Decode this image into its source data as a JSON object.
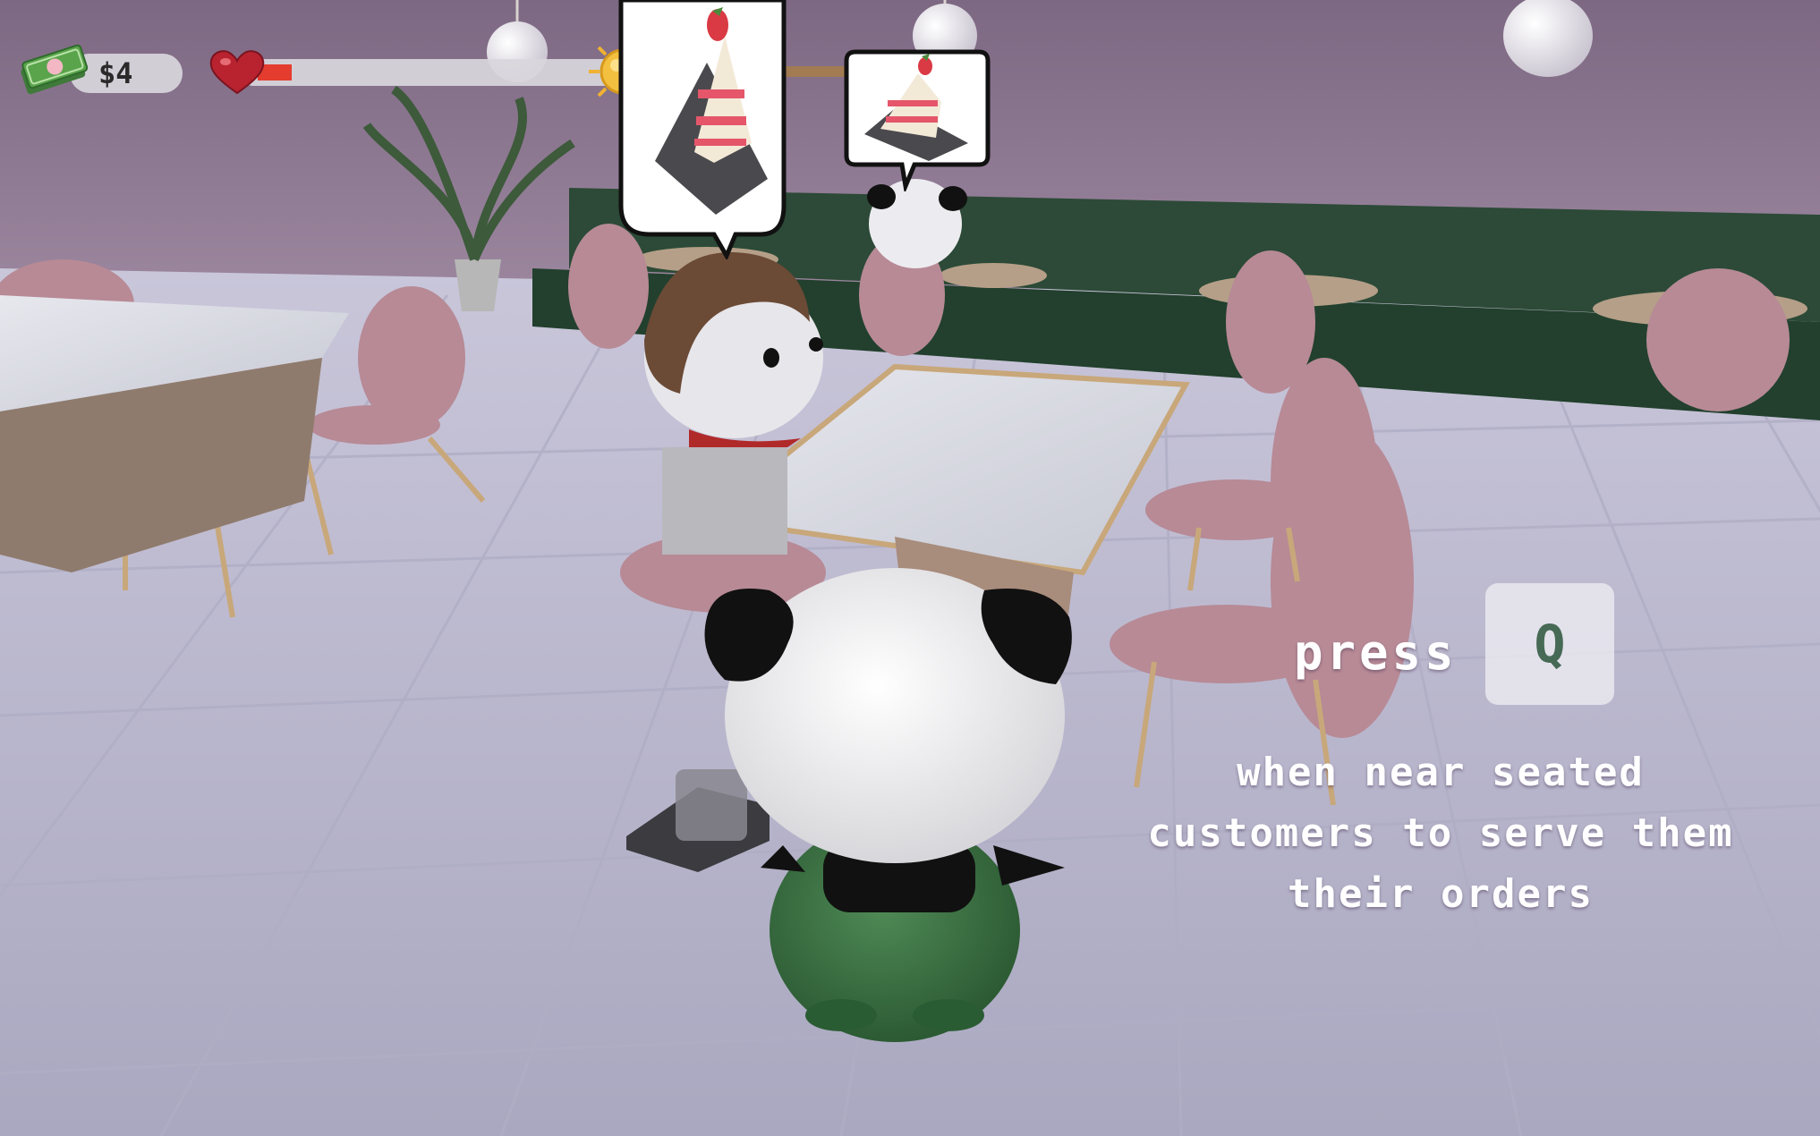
{
  "hud": {
    "money": "$4",
    "health_fraction": 0.05,
    "day_progress_fraction": 0.86
  },
  "icons": {
    "money": "cash-icon",
    "health": "heart-icon",
    "day": "sun-icon",
    "order": "cake-slice-icon"
  },
  "orders": [
    {
      "customer": "dog",
      "item": "strawberry shortcake slice"
    },
    {
      "customer": "panda",
      "item": "strawberry shortcake slice"
    }
  ],
  "tutorial": {
    "press_label": "press",
    "key": "Q",
    "description": "when near seated customers to serve them their orders"
  },
  "colors": {
    "health": "#e43c2e",
    "day": "#a27b52",
    "key_text": "#466a55",
    "wall": "#8a7390",
    "floor": "#c3c2d6",
    "booth": "#274333",
    "chair": "#b78a96"
  }
}
